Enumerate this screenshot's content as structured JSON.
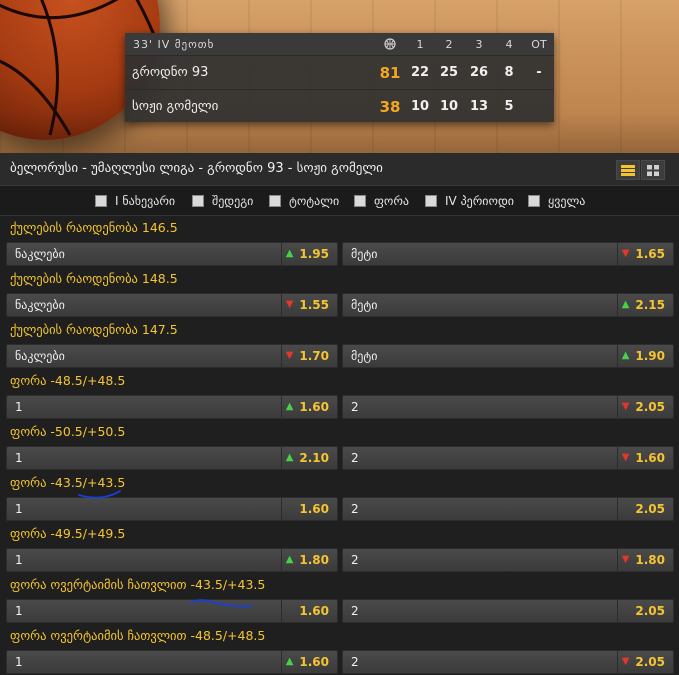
{
  "scoreboard": {
    "time": "33' IV მეოთხ",
    "ball_icon": "basketball-icon",
    "headers": [
      "1",
      "2",
      "3",
      "4",
      "OT"
    ],
    "teams": [
      {
        "name": "გროდნო 93",
        "total": "81",
        "periods": [
          "22",
          "25",
          "26",
          "8",
          "-"
        ]
      },
      {
        "name": "სოჟი გომელი",
        "total": "38",
        "periods": [
          "10",
          "10",
          "13",
          "5",
          ""
        ]
      }
    ]
  },
  "title": "ბელორუსი - უმაღლესი ლიგა - გროდნო 93 - სოჟი გომელი",
  "view_icons": [
    "list-view-icon",
    "grid-view-icon"
  ],
  "filters": [
    "I ნახევარი",
    "შედეგი",
    "ტოტალი",
    "ფორა",
    "IV პერიოდი",
    "ყველა"
  ],
  "markets": [
    {
      "title": "ქულების რაოდენობა 146.5",
      "left": {
        "label": "ნაკლები",
        "odd": "1.95",
        "trend": "up"
      },
      "right": {
        "label": "მეტი",
        "odd": "1.65",
        "trend": "down"
      }
    },
    {
      "title": "ქულების რაოდენობა 148.5",
      "left": {
        "label": "ნაკლები",
        "odd": "1.55",
        "trend": "down"
      },
      "right": {
        "label": "მეტი",
        "odd": "2.15",
        "trend": "up"
      }
    },
    {
      "title": "ქულების რაოდენობა 147.5",
      "left": {
        "label": "ნაკლები",
        "odd": "1.70",
        "trend": "down"
      },
      "right": {
        "label": "მეტი",
        "odd": "1.90",
        "trend": "up"
      }
    },
    {
      "title": "ფორა -48.5/+48.5",
      "left": {
        "label": "1",
        "odd": "1.60",
        "trend": "up"
      },
      "right": {
        "label": "2",
        "odd": "2.05",
        "trend": "down"
      }
    },
    {
      "title": "ფორა -50.5/+50.5",
      "left": {
        "label": "1",
        "odd": "2.10",
        "trend": "up"
      },
      "right": {
        "label": "2",
        "odd": "1.60",
        "trend": "down"
      }
    },
    {
      "title": "ფორა -43.5/+43.5",
      "left": {
        "label": "1",
        "odd": "1.60",
        "trend": "none"
      },
      "right": {
        "label": "2",
        "odd": "2.05",
        "trend": "none"
      }
    },
    {
      "title": "ფორა -49.5/+49.5",
      "left": {
        "label": "1",
        "odd": "1.80",
        "trend": "up"
      },
      "right": {
        "label": "2",
        "odd": "1.80",
        "trend": "down"
      }
    },
    {
      "title": "ფორა ოვერტაიმის ჩათვლით -43.5/+43.5",
      "left": {
        "label": "1",
        "odd": "1.60",
        "trend": "none"
      },
      "right": {
        "label": "2",
        "odd": "2.05",
        "trend": "none"
      }
    },
    {
      "title": "ფორა ოვერტაიმის ჩათვლით -48.5/+48.5",
      "left": {
        "label": "1",
        "odd": "1.60",
        "trend": "up"
      },
      "right": {
        "label": "2",
        "odd": "2.05",
        "trend": "down"
      }
    }
  ],
  "colors": {
    "accent": "#f5c531",
    "score_total": "#f5a623",
    "up": "#45d14a",
    "down": "#e2372b"
  }
}
